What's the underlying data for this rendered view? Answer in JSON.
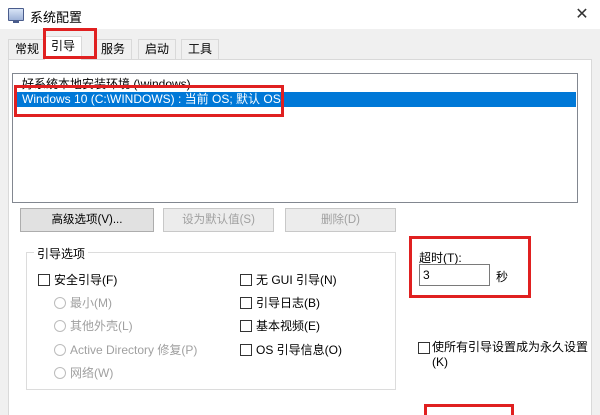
{
  "window": {
    "title": "系统配置"
  },
  "tabs": [
    {
      "label": "常规"
    },
    {
      "label": "引导"
    },
    {
      "label": "服务"
    },
    {
      "label": "启动"
    },
    {
      "label": "工具"
    }
  ],
  "boot_list": [
    {
      "label": "好系统本地安装环境 (\\windows)"
    },
    {
      "label": "Windows 10 (C:\\WINDOWS) : 当前 OS; 默认 OS"
    }
  ],
  "buttons": {
    "advanced": "高级选项(V)...",
    "set_default": "设为默认值(S)",
    "delete": "删除(D)"
  },
  "boot_options": {
    "group_label": "引导选项",
    "safe_boot": "安全引导(F)",
    "minimal": "最小(M)",
    "alternate_shell": "其他外壳(L)",
    "active_directory": "Active Directory 修复(P)",
    "network": "网络(W)",
    "no_gui": "无 GUI 引导(N)",
    "boot_log": "引导日志(B)",
    "base_video": "基本视频(E)",
    "os_info": "OS 引导信息(O)"
  },
  "timeout": {
    "label": "超时(T):",
    "value": "3",
    "unit": "秒"
  },
  "permanent": {
    "label": "使所有引导设置成为永久设置(K)"
  }
}
